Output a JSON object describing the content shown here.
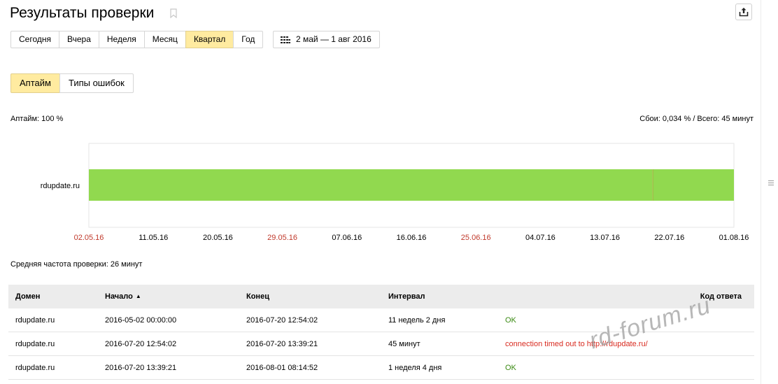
{
  "header": {
    "title": "Результаты проверки"
  },
  "period_buttons": [
    {
      "label": "Сегодня",
      "active": false
    },
    {
      "label": "Вчера",
      "active": false
    },
    {
      "label": "Неделя",
      "active": false
    },
    {
      "label": "Месяц",
      "active": false
    },
    {
      "label": "Квартал",
      "active": true
    },
    {
      "label": "Год",
      "active": false
    }
  ],
  "date_range": {
    "label": "2 май — 1 авг 2016",
    "icon": "calendar-icon"
  },
  "view_tabs": [
    {
      "label": "Аптайм",
      "active": true
    },
    {
      "label": "Типы ошибок",
      "active": false
    }
  ],
  "summary": {
    "uptime": "Аптайм: 100 %",
    "failures": "Сбои: 0,034 % / Всего: 45 минут",
    "avg_frequency": "Средняя частота проверки: 26 минут"
  },
  "chart_data": {
    "type": "timeline",
    "rows": [
      "rdupdate.ru"
    ],
    "x_ticks": [
      {
        "label": "02.05.16",
        "weekend": true
      },
      {
        "label": "11.05.16",
        "weekend": false
      },
      {
        "label": "20.05.16",
        "weekend": false
      },
      {
        "label": "29.05.16",
        "weekend": true
      },
      {
        "label": "07.06.16",
        "weekend": false
      },
      {
        "label": "16.06.16",
        "weekend": false
      },
      {
        "label": "25.06.16",
        "weekend": true
      },
      {
        "label": "04.07.16",
        "weekend": false
      },
      {
        "label": "13.07.16",
        "weekend": false
      },
      {
        "label": "22.07.16",
        "weekend": false
      },
      {
        "label": "01.08.16",
        "weekend": false
      }
    ],
    "segments": [
      {
        "row": "rdupdate.ru",
        "start_day": 0,
        "end_day": 79.54,
        "status": "ok"
      },
      {
        "row": "rdupdate.ru",
        "start_day": 79.54,
        "end_day": 79.57,
        "status": "fail"
      },
      {
        "row": "rdupdate.ru",
        "start_day": 79.57,
        "end_day": 91.34,
        "status": "ok"
      }
    ],
    "range_days": 91,
    "colors": {
      "ok": "#91d94f",
      "fail": "#e05a2a",
      "weekend_tick": "#c0392b",
      "tick": "#000000"
    }
  },
  "table": {
    "columns": [
      "Домен",
      "Начало",
      "Конец",
      "Интервал",
      "Код ответа"
    ],
    "sort_indicator": "▲",
    "rows": [
      {
        "domain": "rdupdate.ru",
        "start": "2016-05-02 00:00:00",
        "end": "2016-07-20 12:54:02",
        "interval": "11 недель 2 дня",
        "code": "OK",
        "status": "ok"
      },
      {
        "domain": "rdupdate.ru",
        "start": "2016-07-20 12:54:02",
        "end": "2016-07-20 13:39:21",
        "interval": "45 минут",
        "code": "connection timed out to http://rdupdate.ru/",
        "status": "err"
      },
      {
        "domain": "rdupdate.ru",
        "start": "2016-07-20 13:39:21",
        "end": "2016-08-01 08:14:52",
        "interval": "1 неделя 4 дня",
        "code": "OK",
        "status": "ok"
      }
    ]
  },
  "watermark": "rd-forum.ru"
}
